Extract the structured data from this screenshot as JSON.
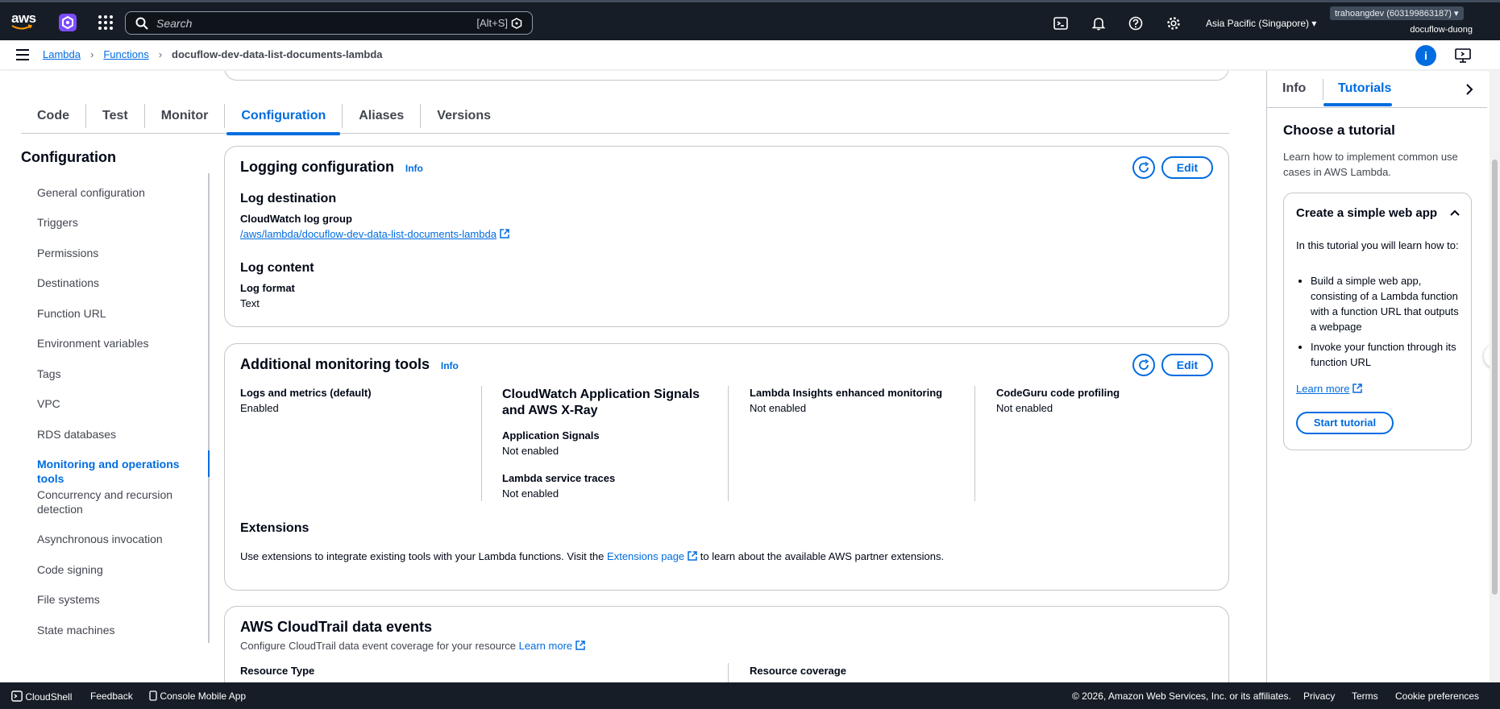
{
  "topbar": {
    "logo_text": "aws",
    "search_placeholder": "Search",
    "search_shortcut": "[Alt+S]",
    "region": "Asia Pacific (Singapore)",
    "account": "trahoangdev (603199863187)",
    "user": "docuflow-duong"
  },
  "breadcrumb": {
    "items": [
      "Lambda",
      "Functions"
    ],
    "current": "docuflow-dev-data-list-documents-lambda",
    "info_badge": "i"
  },
  "tabs": [
    "Code",
    "Test",
    "Monitor",
    "Configuration",
    "Aliases",
    "Versions"
  ],
  "sidenav": {
    "title": "Configuration",
    "items": [
      "General configuration",
      "Triggers",
      "Permissions",
      "Destinations",
      "Function URL",
      "Environment variables",
      "Tags",
      "VPC",
      "RDS databases",
      "Monitoring and operations tools",
      "Concurrency and recursion detection",
      "Asynchronous invocation",
      "Code signing",
      "File systems",
      "State machines"
    ],
    "active_index": 9
  },
  "logging": {
    "title": "Logging configuration",
    "info": "Info",
    "edit": "Edit",
    "dest_heading": "Log destination",
    "log_group_label": "CloudWatch log group",
    "log_group_value": "/aws/lambda/docuflow-dev-data-list-documents-lambda",
    "content_heading": "Log content",
    "format_label": "Log format",
    "format_value": "Text"
  },
  "monitoring": {
    "title": "Additional monitoring tools",
    "info": "Info",
    "edit": "Edit",
    "col1_label": "Logs and metrics (default)",
    "col1_value": "Enabled",
    "col2_heading": "CloudWatch Application Signals and AWS X-Ray",
    "col2_sub1_label": "Application Signals",
    "col2_sub1_value": "Not enabled",
    "col2_sub2_label": "Lambda service traces",
    "col2_sub2_value": "Not enabled",
    "col3_label": "Lambda Insights enhanced monitoring",
    "col3_value": "Not enabled",
    "col4_label": "CodeGuru code profiling",
    "col4_value": "Not enabled",
    "ext_heading": "Extensions",
    "ext_text_before": "Use extensions to integrate existing tools with your Lambda functions. Visit the",
    "ext_link": "Extensions page",
    "ext_text_after": "to learn about the available AWS partner extensions."
  },
  "cloudtrail": {
    "title": "AWS CloudTrail data events",
    "desc": "Configure CloudTrail data event coverage for your resource",
    "learn_more": "Learn more",
    "resource_type_label": "Resource Type",
    "resource_coverage_label": "Resource coverage"
  },
  "right_panel": {
    "tab_info": "Info",
    "tab_tutorials": "Tutorials",
    "heading": "Choose a tutorial",
    "desc": "Learn how to implement common use cases in AWS Lambda.",
    "tutorial_title": "Create a simple web app",
    "tutorial_intro": "In this tutorial you will learn how to:",
    "bullets": [
      "Build a simple web app, consisting of a Lambda function with a function URL that outputs a webpage",
      "Invoke your function through its function URL"
    ],
    "learn_more": "Learn more",
    "start": "Start tutorial"
  },
  "footer": {
    "cloudshell": "CloudShell",
    "feedback": "Feedback",
    "mobile": "Console Mobile App",
    "copyright": "© 2026, Amazon Web Services, Inc. or its affiliates.",
    "privacy": "Privacy",
    "terms": "Terms",
    "cookies": "Cookie preferences"
  },
  "colors": {
    "accent": "#006ce0",
    "topbar": "#161d26"
  }
}
